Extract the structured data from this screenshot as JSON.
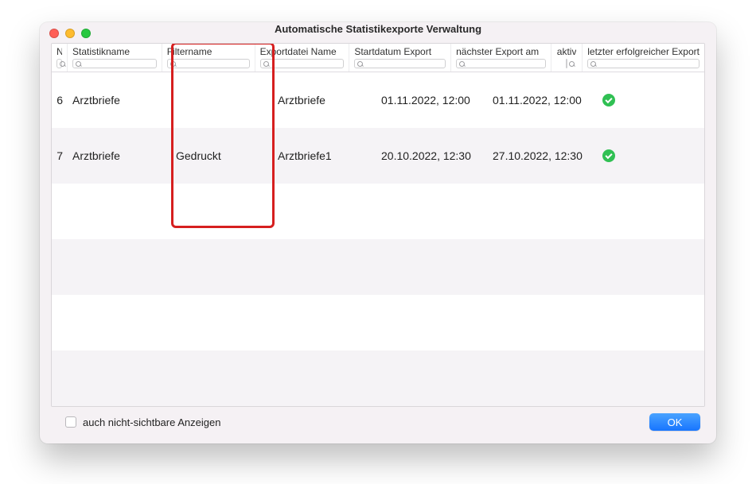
{
  "window": {
    "title": "Automatische Statistikexporte Verwaltung"
  },
  "columns": {
    "n": "N",
    "statistikname": "Statistikname",
    "filtername": "Filtername",
    "exportdatei": "Exportdatei Name",
    "startdatum": "Startdatum Export",
    "naechster": "nächster Export am",
    "aktiv": "aktiv",
    "letzter": "letzter erfolgreicher Export"
  },
  "rows": [
    {
      "n": "6",
      "statistikname": "Arztbriefe",
      "filtername": "",
      "exportdatei": "Arztbriefe",
      "startdatum": "01.11.2022, 12:00",
      "naechster": "01.11.2022, 12:00",
      "aktiv": true,
      "letzter": ""
    },
    {
      "n": "7",
      "statistikname": "Arztbriefe",
      "filtername": "Gedruckt",
      "exportdatei": "Arztbriefe1",
      "startdatum": "20.10.2022, 12:30",
      "naechster": "27.10.2022, 12:30",
      "aktiv": true,
      "letzter": ""
    }
  ],
  "footer": {
    "checkbox_label": "auch nicht-sichtbare Anzeigen",
    "ok": "OK"
  },
  "annotation": {
    "highlight_column": "filtername"
  }
}
